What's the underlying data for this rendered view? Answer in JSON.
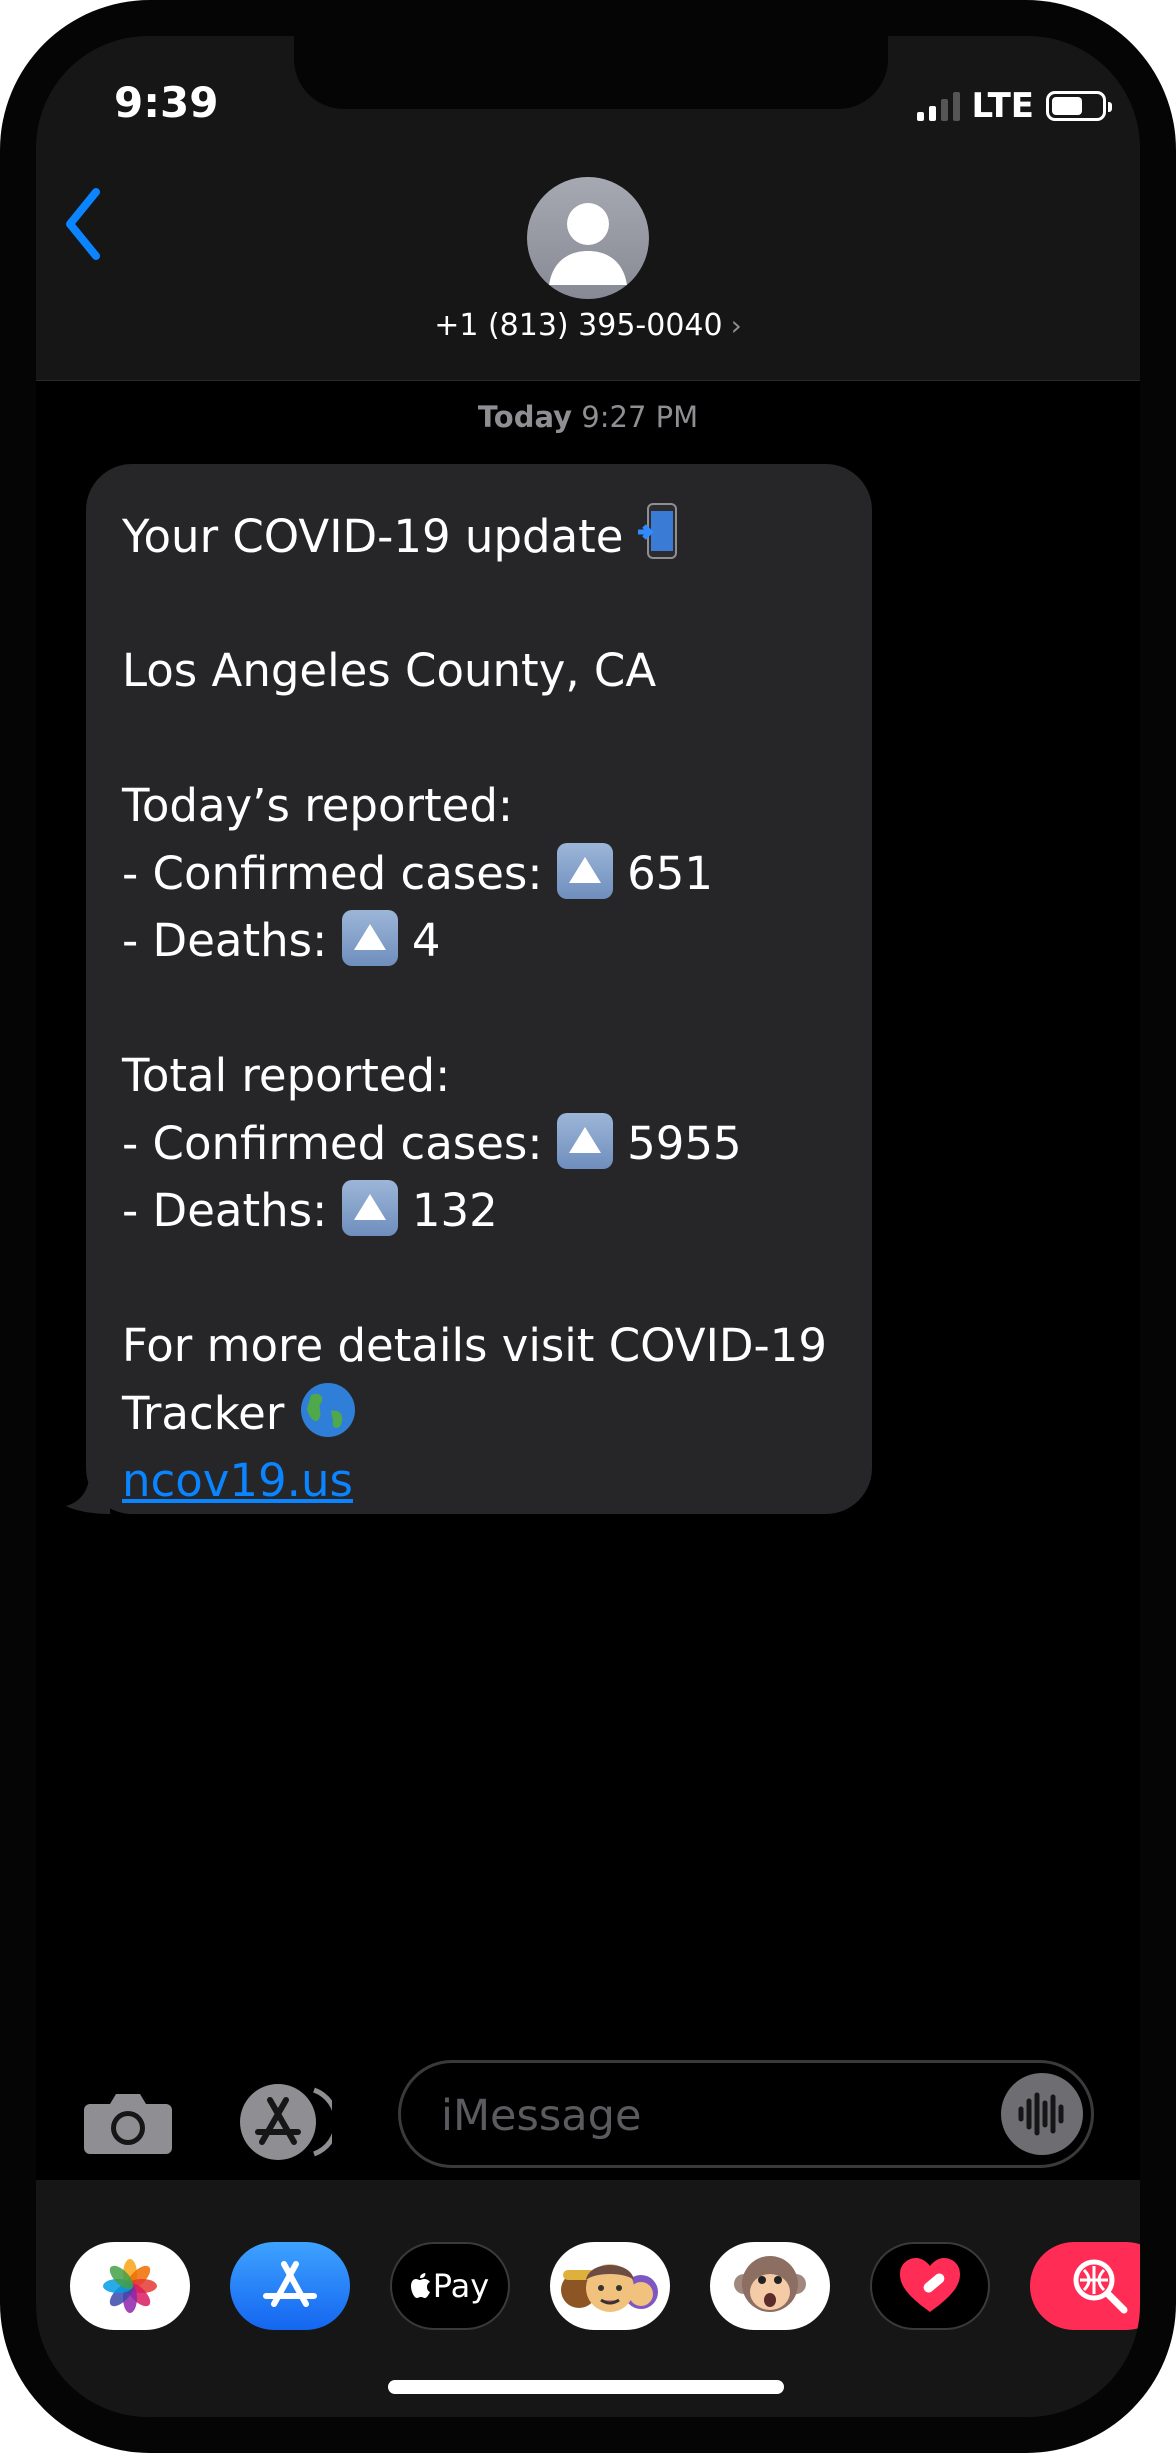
{
  "status_bar": {
    "time": "9:39",
    "network": "LTE"
  },
  "header": {
    "contact": "+1 (813) 395-0040",
    "contact_chevron": "›"
  },
  "thread": {
    "date_label": "Today",
    "time_label": "9:27 PM"
  },
  "message": {
    "lines": [
      {
        "text": "Your COVID-19 update ",
        "emoji": "📲"
      },
      {
        "text": ""
      },
      {
        "text": "Los Angeles County, CA"
      },
      {
        "text": ""
      },
      {
        "text": "Today’s reported:"
      },
      {
        "prefix": "- Confirmed cases: ",
        "value": "651"
      },
      {
        "prefix": "- Deaths: ",
        "value": " 4"
      },
      {
        "text": ""
      },
      {
        "text": "Total reported:"
      },
      {
        "prefix": "- Confirmed cases: ",
        "value": "5955"
      },
      {
        "prefix": "- Deaths: ",
        "value": " 132"
      },
      {
        "text": ""
      },
      {
        "text": "For more details visit COVID-19"
      },
      {
        "text": "Tracker ",
        "emoji": "🌎"
      },
      {
        "link": "ncov19.us"
      }
    ]
  },
  "composer": {
    "placeholder": "iMessage"
  },
  "app_tray": {
    "apple_pay_label": "Pay",
    "apps": [
      "photos-app",
      "app-store-app",
      "apple-pay-app",
      "memoji-app",
      "animoji-app",
      "digital-touch-app",
      "image-search-app"
    ]
  },
  "colors": {
    "accent": "#0a84ff",
    "bubble": "#262628",
    "background": "#000000"
  }
}
